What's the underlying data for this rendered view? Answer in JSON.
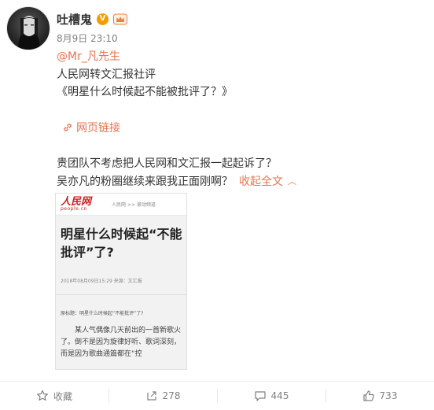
{
  "user": {
    "name": "吐槽鬼",
    "verified_badge": "V",
    "timestamp": "8月9日 23:10"
  },
  "post": {
    "mention": "@Mr_凡先生",
    "line1": "人民网转文汇报社评",
    "line2": "《明星什么时候起不能被批评了？》",
    "web_link": "网页链接",
    "line3": "贵团队不考虑把人民网和文汇报一起起诉了？",
    "line4": "吴亦凡的粉圈继续来跟我正面刚啊？",
    "collapse": "收起全文"
  },
  "article_image": {
    "logo_main": "人民网",
    "logo_sub": "people.cn",
    "breadcrumb": "人民网 >> 滚动频道",
    "title": "明星什么时候起“不能批评”了?",
    "date_source": "2018年08月09日15:29  来源：文汇报",
    "summary": "原标题：明星什么时候起“不能批评”了?",
    "paragraph": "某人气偶像几天前出的一首新歌火了。倒不是因为旋律好听、歌词深刻，而是因为歌曲通篇都在“控"
  },
  "actions": {
    "favorite": "收藏",
    "repost_count": "278",
    "comment_count": "445",
    "like_count": "733"
  },
  "colors": {
    "accent": "#eb7350",
    "badge": "#f59b00",
    "muted": "#808080"
  },
  "icons": [
    "star-icon",
    "repost-icon",
    "comment-icon",
    "like-icon",
    "link-icon",
    "crown-icon",
    "chevron-up-icon"
  ]
}
